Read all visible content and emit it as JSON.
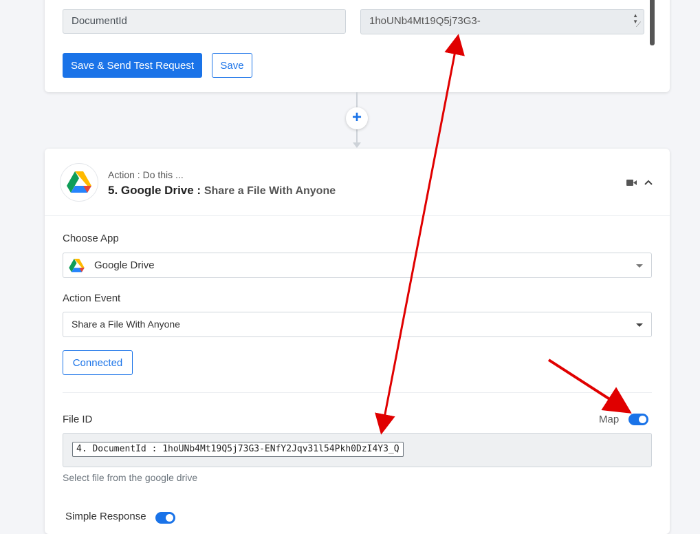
{
  "previous_step": {
    "field_name": "DocumentId",
    "field_value": "1hoUNb4Mt19Q5j73G3-",
    "save_send_label": "Save & Send Test Request",
    "save_label": "Save"
  },
  "connector": {
    "add_symbol": "+"
  },
  "action": {
    "subtitle": "Action : Do this ...",
    "step_title": "5. Google Drive : ",
    "event_desc": "Share a File With Anyone",
    "choose_app_label": "Choose App",
    "choose_app_value": "Google Drive",
    "action_event_label": "Action Event",
    "action_event_value": "Share a File With Anyone",
    "connected_label": "Connected",
    "file_id_label": "File ID",
    "map_label": "Map",
    "map_toggle_on": true,
    "file_id_mapping": "4. DocumentId : 1hoUNb4Mt19Q5j73G3-ENfY2Jqv31l54Pkh0DzI4Y3_Q",
    "file_id_help": "Select file from the google drive",
    "simple_response_label": "Simple Response",
    "simple_response_on": true
  },
  "colors": {
    "accent": "#1a73e8",
    "annotation": "#e00000",
    "background": "#f4f5f8"
  },
  "icons": [
    "google-drive-icon",
    "video-camera-icon",
    "chevron-up-icon",
    "caret-down-icon",
    "plus-icon"
  ]
}
